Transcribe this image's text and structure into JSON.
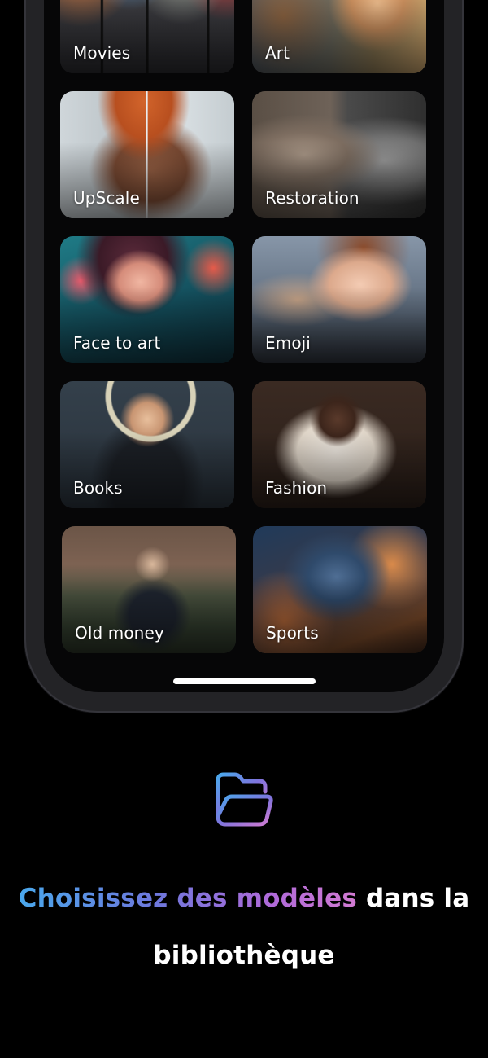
{
  "templates": [
    {
      "label": "Movies",
      "icon": "movies-thumbnail"
    },
    {
      "label": "Art",
      "icon": "art-thumbnail"
    },
    {
      "label": "UpScale",
      "icon": "upscale-thumbnail"
    },
    {
      "label": "Restoration",
      "icon": "restoration-thumbnail"
    },
    {
      "label": "Face to art",
      "icon": "face-to-art-thumbnail"
    },
    {
      "label": "Emoji",
      "icon": "emoji-thumbnail"
    },
    {
      "label": "Books",
      "icon": "books-thumbnail"
    },
    {
      "label": "Fashion",
      "icon": "fashion-thumbnail"
    },
    {
      "label": "Old money",
      "icon": "old-money-thumbnail"
    },
    {
      "label": "Sports",
      "icon": "sports-thumbnail"
    }
  ],
  "promo": {
    "icon": "folder-icon",
    "headline_highlight": "Choisissez des modèles",
    "headline_rest": " dans la bibliothèque"
  },
  "colors": {
    "background": "#000000",
    "phone_frame": "#232326",
    "gradient_start": "#4aa8ec",
    "gradient_mid": "#b06ad9",
    "gradient_end": "#d27bd2"
  }
}
